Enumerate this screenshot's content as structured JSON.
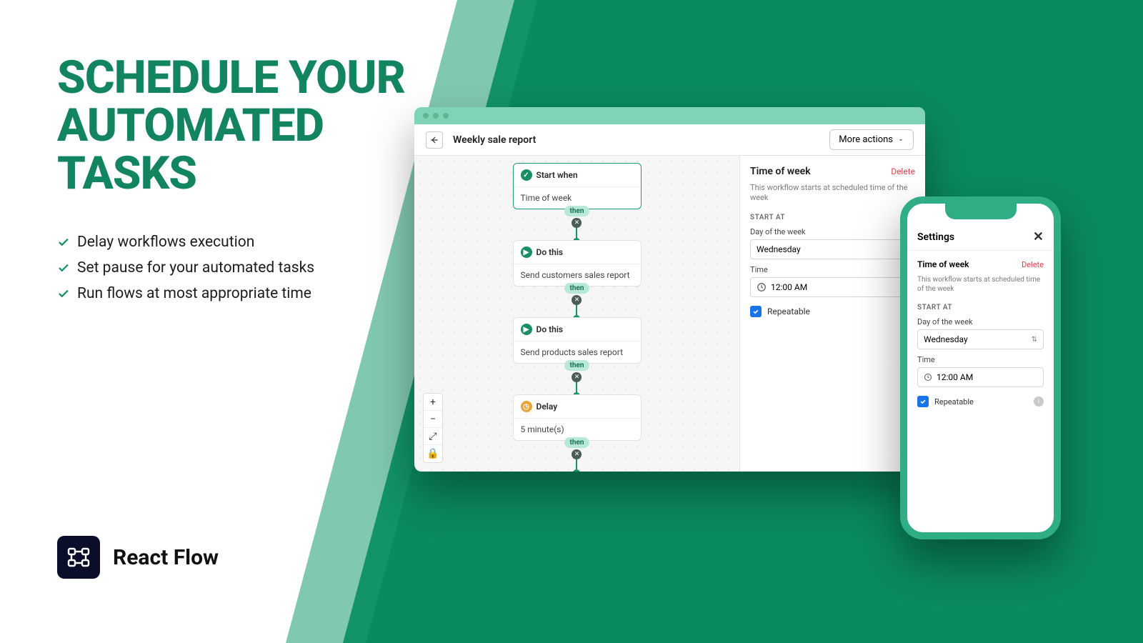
{
  "headline": "SCHEDULE YOUR AUTOMATED TASKS",
  "bullets": [
    "Delay workflows execution",
    "Set pause for your automated tasks",
    "Run flows at most appropriate time"
  ],
  "brand": "React Flow",
  "window": {
    "title": "Weekly sale report",
    "more": "More actions",
    "nodes": [
      {
        "kind": "start",
        "title": "Start when",
        "sub": "Time of week"
      },
      {
        "kind": "action",
        "title": "Do this",
        "sub": "Send customers sales report"
      },
      {
        "kind": "action",
        "title": "Do this",
        "sub": "Send products sales report"
      },
      {
        "kind": "delay",
        "title": "Delay",
        "sub": "5 minute(s)"
      }
    ],
    "connector_label": "then"
  },
  "panel": {
    "title": "Time of week",
    "delete": "Delete",
    "desc": "This workflow starts at scheduled time of the week",
    "section": "START AT",
    "day_label": "Day of the week",
    "day_value": "Wednesday",
    "time_label": "Time",
    "time_value": "12:00 AM",
    "repeat": "Repeatable"
  },
  "phone": {
    "header": "Settings",
    "title": "Time of week",
    "delete": "Delete",
    "desc": "This workflow starts at scheduled time of the week",
    "section": "START AT",
    "day_label": "Day of the week",
    "day_value": "Wednesday",
    "time_label": "Time",
    "time_value": "12:00 AM",
    "repeat": "Repeatable"
  }
}
